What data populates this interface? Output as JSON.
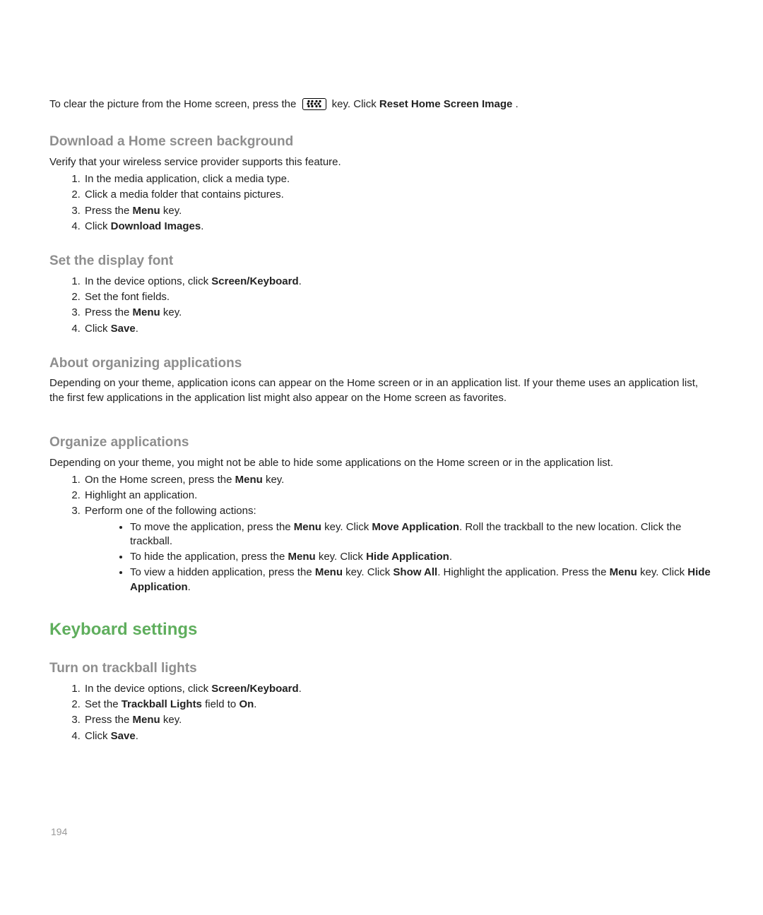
{
  "intro": {
    "pre": "To clear the picture from the Home screen, press the ",
    "post_key": " key. Click ",
    "bold": "Reset Home Screen Image",
    "end": "."
  },
  "download": {
    "heading": "Download a Home screen background",
    "lead": "Verify that your wireless service provider supports this feature.",
    "step1": "In the media application, click a media type.",
    "step2": "Click a media folder that contains pictures.",
    "step3_pre": "Press the ",
    "step3_bold": "Menu",
    "step3_post": " key.",
    "step4_pre": "Click ",
    "step4_bold": "Download Images",
    "step4_post": "."
  },
  "font": {
    "heading": "Set the display font",
    "step1_pre": "In the device options, click ",
    "step1_bold": "Screen/Keyboard",
    "step1_post": ".",
    "step2": "Set the font fields.",
    "step3_pre": "Press the ",
    "step3_bold": "Menu",
    "step3_post": " key.",
    "step4_pre": "Click ",
    "step4_bold": "Save",
    "step4_post": "."
  },
  "about": {
    "heading": "About organizing applications",
    "para": "Depending on your theme, application icons can appear on the Home screen or in an application list. If your theme uses an application list, the first few applications in the application list might also appear on the Home screen as favorites."
  },
  "organize": {
    "heading": "Organize applications",
    "lead": "Depending on your theme, you might not be able to hide some applications on the Home screen or in the application list.",
    "step1_pre": "On the Home screen, press the ",
    "step1_bold": "Menu",
    "step1_post": " key.",
    "step2": "Highlight an application.",
    "step3": "Perform one of the following actions:",
    "b1_a": "To move the application, press the ",
    "b1_b": "Menu",
    "b1_c": " key. Click ",
    "b1_d": "Move Application",
    "b1_e": ". Roll the trackball to the new location.  Click the trackball.",
    "b2_a": "To hide the application, press the ",
    "b2_b": "Menu",
    "b2_c": " key. Click ",
    "b2_d": "Hide Application",
    "b2_e": ".",
    "b3_a": "To view a hidden application, press the ",
    "b3_b": "Menu",
    "b3_c": " key. Click ",
    "b3_d": "Show All",
    "b3_e": ". Highlight the application. Press the ",
    "b3_f": "Menu",
    "b3_g": " key. Click ",
    "b3_h": "Hide Application",
    "b3_i": "."
  },
  "keyboard": {
    "heading": "Keyboard settings"
  },
  "trackball": {
    "heading": "Turn on trackball lights",
    "step1_pre": "In the device options, click ",
    "step1_bold": "Screen/Keyboard",
    "step1_post": ".",
    "step2_pre": "Set the ",
    "step2_bold1": "Trackball Lights",
    "step2_mid": " field to ",
    "step2_bold2": "On",
    "step2_post": ".",
    "step3_pre": "Press the ",
    "step3_bold": "Menu",
    "step3_post": " key.",
    "step4_pre": "Click ",
    "step4_bold": "Save",
    "step4_post": "."
  },
  "page_number": "194",
  "icons": {
    "menu_key": "blackberry-menu-key"
  }
}
